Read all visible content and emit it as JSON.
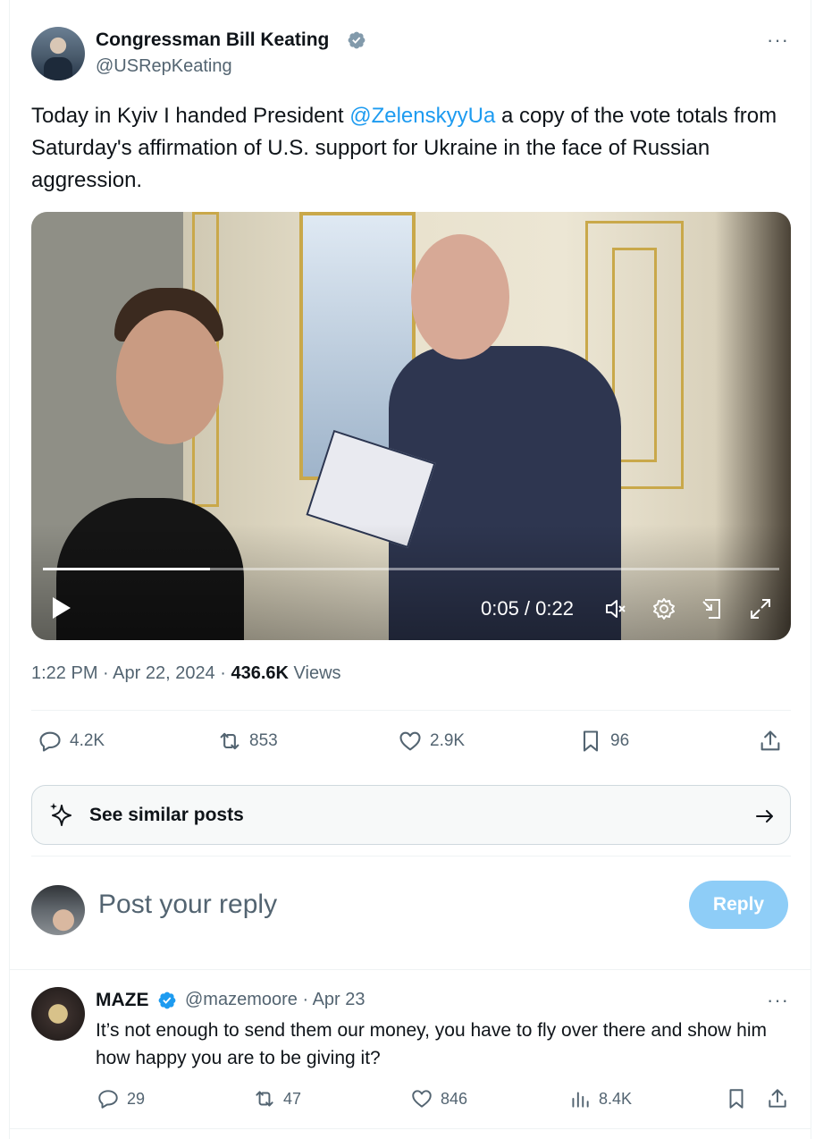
{
  "post": {
    "author_name": "Congressman Bill Keating",
    "author_handle": "@USRepKeating",
    "text_before": "Today in Kyiv I handed President ",
    "mention": "@ZelenskyyUa",
    "text_after": " a copy of the vote totals from Saturday's affirmation of U.S. support for Ukraine in the face of Russian aggression.",
    "video": {
      "time": "0:05 / 0:22",
      "progress": 0.227
    },
    "timestamp": "1:22 PM · Apr 22, 2024 · ",
    "views_count": "436.6K",
    "views_label": " Views",
    "stats": {
      "replies": "4.2K",
      "reposts": "853",
      "likes": "2.9K",
      "bookmarks": "96"
    }
  },
  "similar": {
    "label": "See similar posts"
  },
  "composer": {
    "placeholder": "Post your reply",
    "reply_label": "Reply"
  },
  "comment": {
    "author_name": "MAZE",
    "handle_date": "@mazemoore · Apr 23",
    "text": "It’s not enough to send them our money, you have to fly over there and show him how happy you are to be giving it?",
    "stats": {
      "replies": "29",
      "reposts": "47",
      "likes": "846",
      "views": "8.4K"
    }
  },
  "colors": {
    "accent": "#1d9bf0",
    "reply_button": "#8ecdf7",
    "secondary_text": "#536471"
  }
}
